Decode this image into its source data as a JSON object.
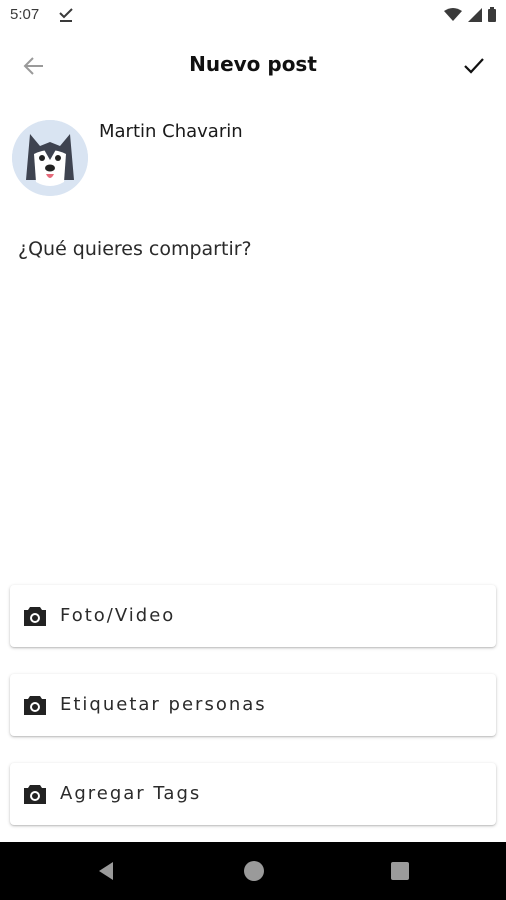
{
  "status_bar": {
    "time": "5:07"
  },
  "header": {
    "title": "Nuevo post"
  },
  "user": {
    "name": "Martin Chavarin"
  },
  "composer": {
    "placeholder": "¿Qué quieres compartir?"
  },
  "actions": [
    {
      "label": "Foto/Video",
      "icon": "camera-icon"
    },
    {
      "label": "Etiquetar personas",
      "icon": "camera-icon"
    },
    {
      "label": "Agregar Tags",
      "icon": "camera-icon"
    }
  ],
  "nav_bar": {
    "buttons": [
      "back-triangle-icon",
      "home-circle-icon",
      "recents-square-icon"
    ]
  },
  "colors": {
    "background": "#ffffff",
    "text": "#1b1b1b",
    "nav_bar": "#000000",
    "avatar_bg": "#d9e4f2"
  }
}
